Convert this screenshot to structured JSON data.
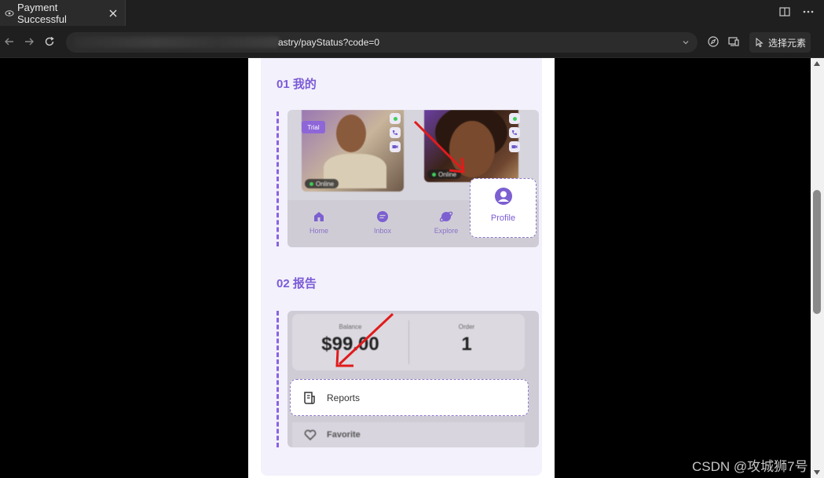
{
  "tab": {
    "title": "Payment Successful"
  },
  "address": {
    "url_visible": "astry/payStatus?code=0",
    "inspect_label": "选择元素"
  },
  "sections": [
    {
      "title": "01 我的"
    },
    {
      "title": "02 报告"
    }
  ],
  "profile_shot": {
    "trial_tag": "Trial",
    "online_label": "Online",
    "nav": [
      "Home",
      "Inbox",
      "Explore"
    ],
    "highlight_label": "Profile"
  },
  "report_shot": {
    "balance_label": "Balance",
    "balance_value": "$99.00",
    "order_label": "Order",
    "order_value": "1",
    "highlight_label": "Reports",
    "favorite_label": "Favorite"
  },
  "watermark": "CSDN @攻城狮7号",
  "colors": {
    "accent": "#7b5bd6",
    "card_bg": "#f3f1fc",
    "arrow": "#e11b1b"
  }
}
